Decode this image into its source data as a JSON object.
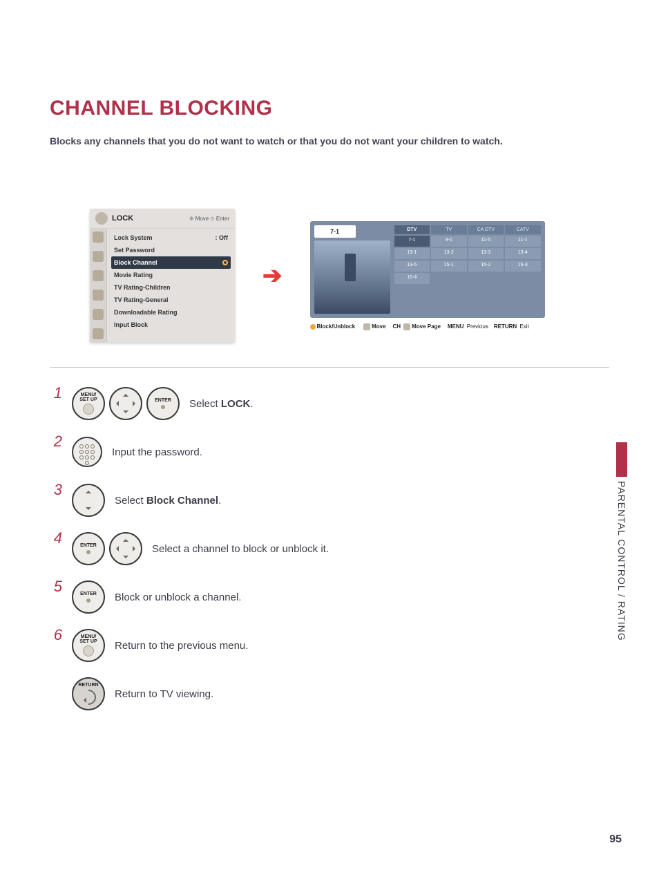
{
  "page": {
    "title": "CHANNEL BLOCKING",
    "subtitle": "Blocks any channels that you do not want to watch or that you do not want your children to watch.",
    "section": "PARENTAL CONTROL / RATING",
    "number": "95"
  },
  "lock_menu": {
    "title": "LOCK",
    "hint_move_glyph": "✥",
    "hint_move": "Move",
    "hint_enter_glyph": "⊙",
    "hint_enter": "Enter",
    "items": [
      {
        "label": "Lock System",
        "value": ": Off",
        "selected": false
      },
      {
        "label": "Set Password",
        "value": "",
        "selected": false
      },
      {
        "label": "Block Channel",
        "value": "",
        "selected": true
      },
      {
        "label": "Movie Rating",
        "value": "",
        "selected": false
      },
      {
        "label": "TV Rating-Children",
        "value": "",
        "selected": false
      },
      {
        "label": "TV Rating-General",
        "value": "",
        "selected": false
      },
      {
        "label": "Downloadable Rating",
        "value": "",
        "selected": false
      },
      {
        "label": "Input Block",
        "value": "",
        "selected": false
      }
    ]
  },
  "arrow": "➔",
  "channel_panel": {
    "current": "7-1",
    "tabs": [
      "DTV",
      "TV",
      "CA DTV",
      "CATV"
    ],
    "tabs_active_index": 0,
    "cells": [
      "7-1",
      "9-1",
      "11-5",
      "11-1",
      "13-1",
      "13-2",
      "13-3",
      "13-4",
      "13-5",
      "15-1",
      "15-2",
      "15-3",
      "15-4",
      "",
      "",
      ""
    ],
    "selected_index": 0,
    "footer": {
      "block": "Block/Unblock",
      "move": "Move",
      "ch_label": "CH",
      "move_page": "Move Page",
      "menu_key": "MENU",
      "previous": "Previous",
      "return_key": "RETURN",
      "exit": "Exit"
    }
  },
  "buttons": {
    "menu": "MENU/\nSET UP",
    "enter": "ENTER",
    "return": "RETURN"
  },
  "steps": [
    {
      "num": "1",
      "text_pre": "Select ",
      "bold": "LOCK",
      "text_post": "."
    },
    {
      "num": "2",
      "text_pre": "Input the password.",
      "bold": "",
      "text_post": ""
    },
    {
      "num": "3",
      "text_pre": "Select ",
      "bold": "Block Channel",
      "text_post": "."
    },
    {
      "num": "4",
      "text_pre": "Select a channel to block or unblock it.",
      "bold": "",
      "text_post": ""
    },
    {
      "num": "5",
      "text_pre": "Block or unblock a channel.",
      "bold": "",
      "text_post": ""
    },
    {
      "num": "6",
      "text_pre": "Return to the previous menu.",
      "bold": "",
      "text_post": ""
    },
    {
      "num": "",
      "text_pre": "Return to TV viewing.",
      "bold": "",
      "text_post": ""
    }
  ]
}
